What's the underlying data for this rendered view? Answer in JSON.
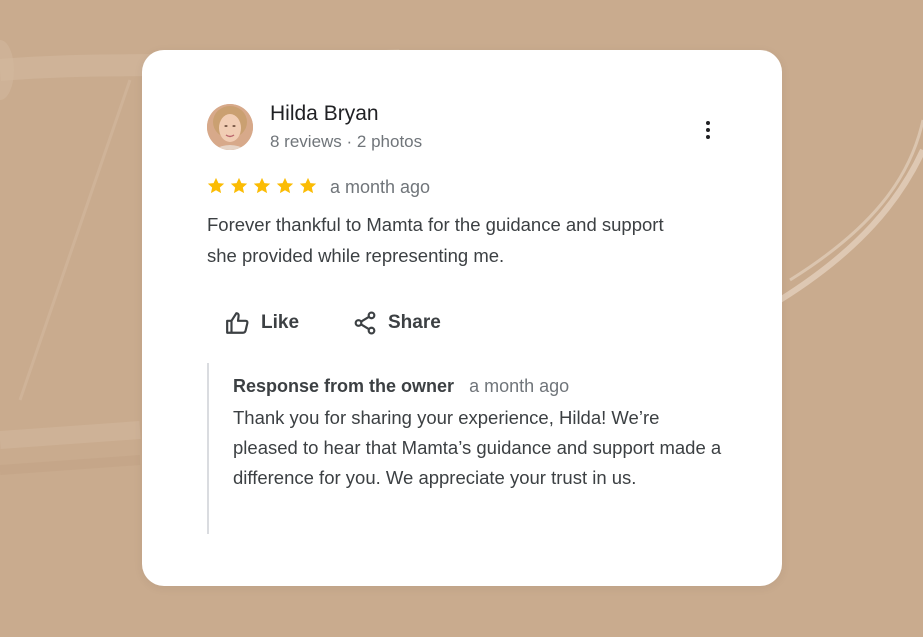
{
  "review": {
    "author": {
      "name": "Hilda Bryan",
      "meta": "8 reviews · 2 photos"
    },
    "rating": 5,
    "time": "a month ago",
    "text": "Forever thankful to Mamta for the guidance and support she provided while representing me."
  },
  "actions": {
    "like_label": "Like",
    "share_label": "Share"
  },
  "owner_response": {
    "label": "Response from the owner",
    "time": "a month ago",
    "text": "Thank you for sharing your experience, Hilda! We’re pleased to hear that Mamta’s guidance and support made a difference for you. We appreciate your trust in us."
  },
  "icons": {
    "menu": "more-vert-icon",
    "star": "star-icon",
    "like": "thumbs-up-icon",
    "share": "share-icon"
  },
  "colors": {
    "background": "#c9ab8e",
    "card": "#ffffff",
    "star": "#fbbc04",
    "primary_text": "#202124",
    "secondary_text": "#70757a"
  }
}
